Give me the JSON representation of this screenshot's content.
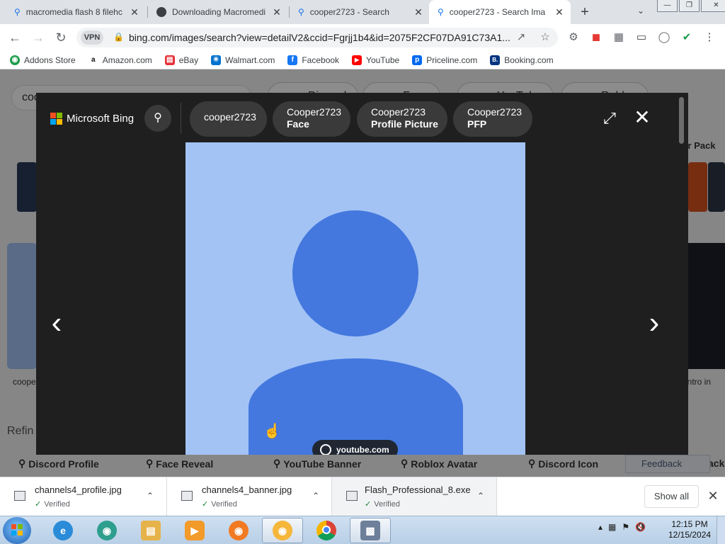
{
  "tabs": [
    {
      "title": "macromedia flash 8 filehc",
      "icon": "search-icon",
      "active": false
    },
    {
      "title": "Downloading Macromedi",
      "icon": "globe-icon",
      "active": false
    },
    {
      "title": "cooper2723 - Search",
      "icon": "search-icon",
      "active": false
    },
    {
      "title": "cooper2723 - Search Ima",
      "icon": "search-icon",
      "active": true
    }
  ],
  "toolbar": {
    "url": "bing.com/images/search?view=detailV2&ccid=Fgrjj1b4&id=2075F2CF07DA91C73A1...",
    "vpn_label": "VPN"
  },
  "bookmarks": [
    {
      "label": "Addons Store",
      "icon": "addons-icon",
      "color": "#1a9c4a",
      "glyph": "◉"
    },
    {
      "label": "Amazon.com",
      "icon": "amazon-icon",
      "color": "#111111",
      "glyph": "a"
    },
    {
      "label": "eBay",
      "icon": "ebay-icon",
      "color": "#e53238",
      "glyph": "▤"
    },
    {
      "label": "Walmart.com",
      "icon": "walmart-icon",
      "color": "#0071ce",
      "glyph": "✳"
    },
    {
      "label": "Facebook",
      "icon": "facebook-icon",
      "color": "#1877f2",
      "glyph": "f"
    },
    {
      "label": "YouTube",
      "icon": "youtube-icon",
      "color": "#ff0000",
      "glyph": "▶"
    },
    {
      "label": "Priceline.com",
      "icon": "priceline-icon",
      "color": "#0068ef",
      "glyph": "p"
    },
    {
      "label": "Booking.com",
      "icon": "booking-icon",
      "color": "#003580",
      "glyph": "B."
    }
  ],
  "background": {
    "search_value": "coo",
    "pills": [
      "Discord",
      "Face",
      "YouTube",
      "Roblox"
    ],
    "left_caption": "coope",
    "refine_label": "Refin",
    "right_caption": "g intro in",
    "right_heading": "ter Pack",
    "related": [
      "Discord Profile",
      "Face Reveal",
      "YouTube Banner",
      "Roblox Avatar",
      "Discord Icon",
      "ack"
    ],
    "feedback_label": "Feedback"
  },
  "modal": {
    "brand": "Microsoft Bing",
    "chips": [
      {
        "line1": "cooper2723",
        "line2": ""
      },
      {
        "line1": "Cooper2723",
        "line2": "Face"
      },
      {
        "line1": "Cooper2723",
        "line2": "Profile Picture"
      },
      {
        "line1": "Cooper2723",
        "line2": "PFP"
      }
    ],
    "source_label": "youtube.com",
    "colors": {
      "image_bg": "#a3c3f5",
      "avatar": "#4478de",
      "modal_bg": "#1f1f1f"
    }
  },
  "downloads": [
    {
      "name": "channels4_profile.jpg",
      "status": "Verified"
    },
    {
      "name": "channels4_banner.jpg",
      "status": "Verified"
    },
    {
      "name": "Flash_Professional_8.exe",
      "status": "Verified"
    }
  ],
  "downloads_bar": {
    "show_all_label": "Show all"
  },
  "taskbar": {
    "time": "12:15 PM",
    "date": "12/15/2024",
    "apps": [
      "internet-explorer-icon",
      "app-icon",
      "file-explorer-icon",
      "media-player-icon",
      "brave-icon",
      "brave-icon",
      "chrome-icon",
      "installer-icon"
    ]
  }
}
